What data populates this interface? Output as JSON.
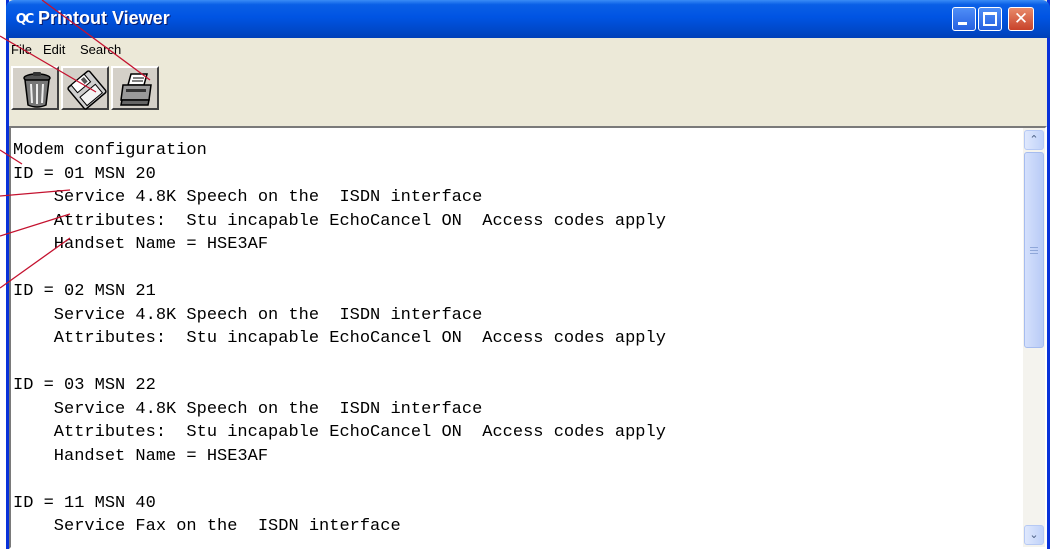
{
  "window": {
    "title": "Printout Viewer",
    "app_icon_text": "QC",
    "controls": {
      "minimize": "minimize",
      "maximize": "maximize",
      "close": "✕"
    }
  },
  "menu": {
    "items": [
      "File",
      "Edit",
      "Search"
    ]
  },
  "toolbar": {
    "buttons": [
      {
        "icon": "trash-can-icon"
      },
      {
        "icon": "floppy-disk-icon"
      },
      {
        "icon": "printer-icon"
      }
    ]
  },
  "document": {
    "lines": [
      "Modem configuration",
      "ID = 01 MSN 20",
      "    Service 4.8K Speech on the  ISDN interface",
      "    Attributes:  Stu incapable EchoCancel ON  Access codes apply",
      "    Handset Name = HSE3AF",
      "",
      "ID = 02 MSN 21",
      "    Service 4.8K Speech on the  ISDN interface",
      "    Attributes:  Stu incapable EchoCancel ON  Access codes apply",
      "",
      "ID = 03 MSN 22",
      "    Service 4.8K Speech on the  ISDN interface",
      "    Attributes:  Stu incapable EchoCancel ON  Access codes apply",
      "    Handset Name = HSE3AF",
      "",
      "ID = 11 MSN 40",
      "    Service Fax on the  ISDN interface"
    ]
  },
  "colors": {
    "title_bar": "#0054e3",
    "callout_lines": "#c4122f",
    "window_face": "#ece9d8"
  }
}
